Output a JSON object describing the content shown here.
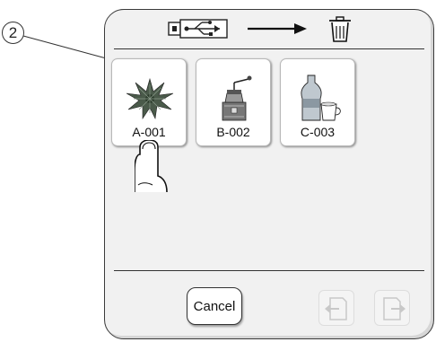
{
  "annotation": {
    "number": "2"
  },
  "header": {
    "source_icon": "usb-icon",
    "arrow_icon": "right-arrow-icon",
    "target_icon": "trash-icon"
  },
  "thumbnails": [
    {
      "name": "A-001",
      "icon": "poinsettia-embroidery-icon"
    },
    {
      "name": "B-002",
      "icon": "coffee-grinder-embroidery-icon"
    },
    {
      "name": "C-003",
      "icon": "bottle-and-cup-embroidery-icon"
    }
  ],
  "footer": {
    "cancel_label": "Cancel",
    "prev_icon": "page-back-icon",
    "next_icon": "page-forward-icon"
  },
  "overlay": {
    "finger_icon": "pointing-finger-icon"
  },
  "colors": {
    "frame": "#3a3a3a",
    "panel": "#f1f1f1",
    "disabled": "#c8c8c8"
  }
}
